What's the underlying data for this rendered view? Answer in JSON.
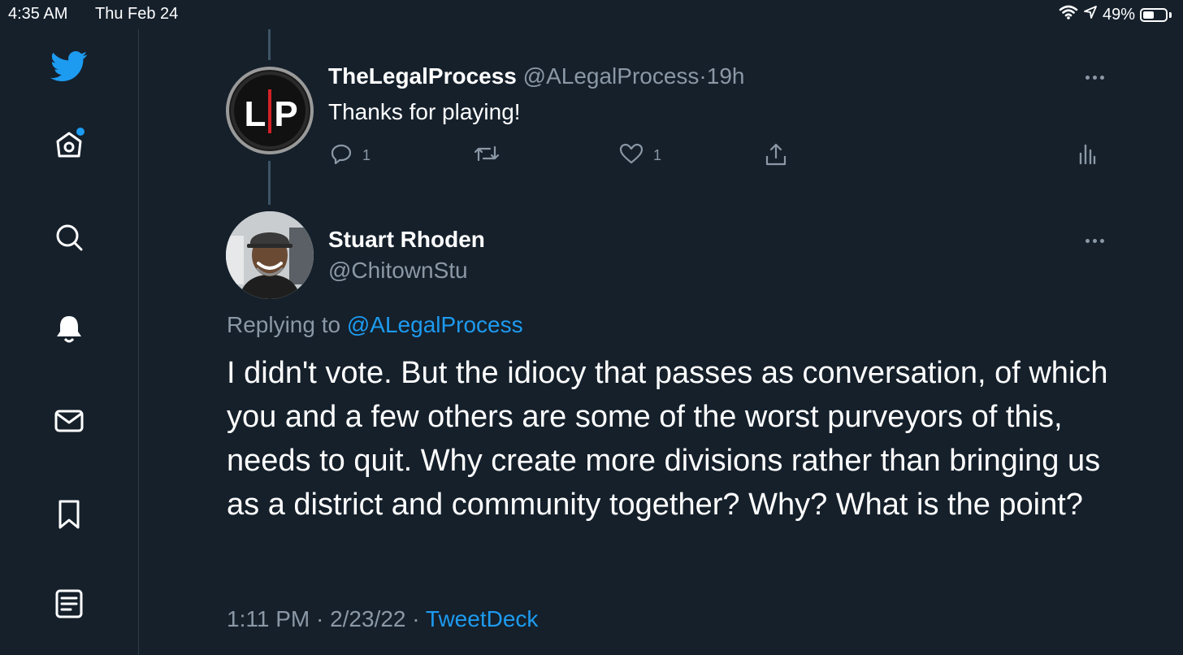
{
  "status_bar": {
    "time": "4:35 AM",
    "date": "Thu Feb 24",
    "battery": "49%",
    "battery_level": 0.49,
    "icons": [
      "wifi-icon",
      "location-arrow-icon",
      "battery-icon"
    ]
  },
  "sidebar": {
    "items": [
      {
        "name": "twitter-logo-icon"
      },
      {
        "name": "home-icon",
        "has_notification_dot": true
      },
      {
        "name": "search-icon"
      },
      {
        "name": "notifications-bell-icon"
      },
      {
        "name": "messages-mail-icon"
      },
      {
        "name": "bookmarks-icon"
      },
      {
        "name": "lists-icon"
      }
    ]
  },
  "parent_tweet": {
    "avatar_text": "LP",
    "display_name": "TheLegalProcess",
    "handle": "@ALegalProcess",
    "separator": "·",
    "time_ago": "19h",
    "text": "Thanks for playing!",
    "reply_count": "1",
    "like_count": "1"
  },
  "main_tweet": {
    "display_name": "Stuart Rhoden",
    "handle": "@ChitownStu",
    "replying_prefix": "Replying to",
    "replying_handle": "@ALegalProcess",
    "text": "I didn't vote. But the idiocy that passes as conversation, of which you and a few others are some of the worst purveyors of this, needs to quit. Why create more divisions rather than bringing us as a district and community together? Why? What is the point?",
    "timestamp": "1:11 PM · 2/23/22 ·",
    "source": "TweetDeck"
  },
  "colors": {
    "background": "#15202b",
    "accent": "#1d9bf0",
    "muted_text": "#8b98a5",
    "lp_red": "#d42128"
  }
}
